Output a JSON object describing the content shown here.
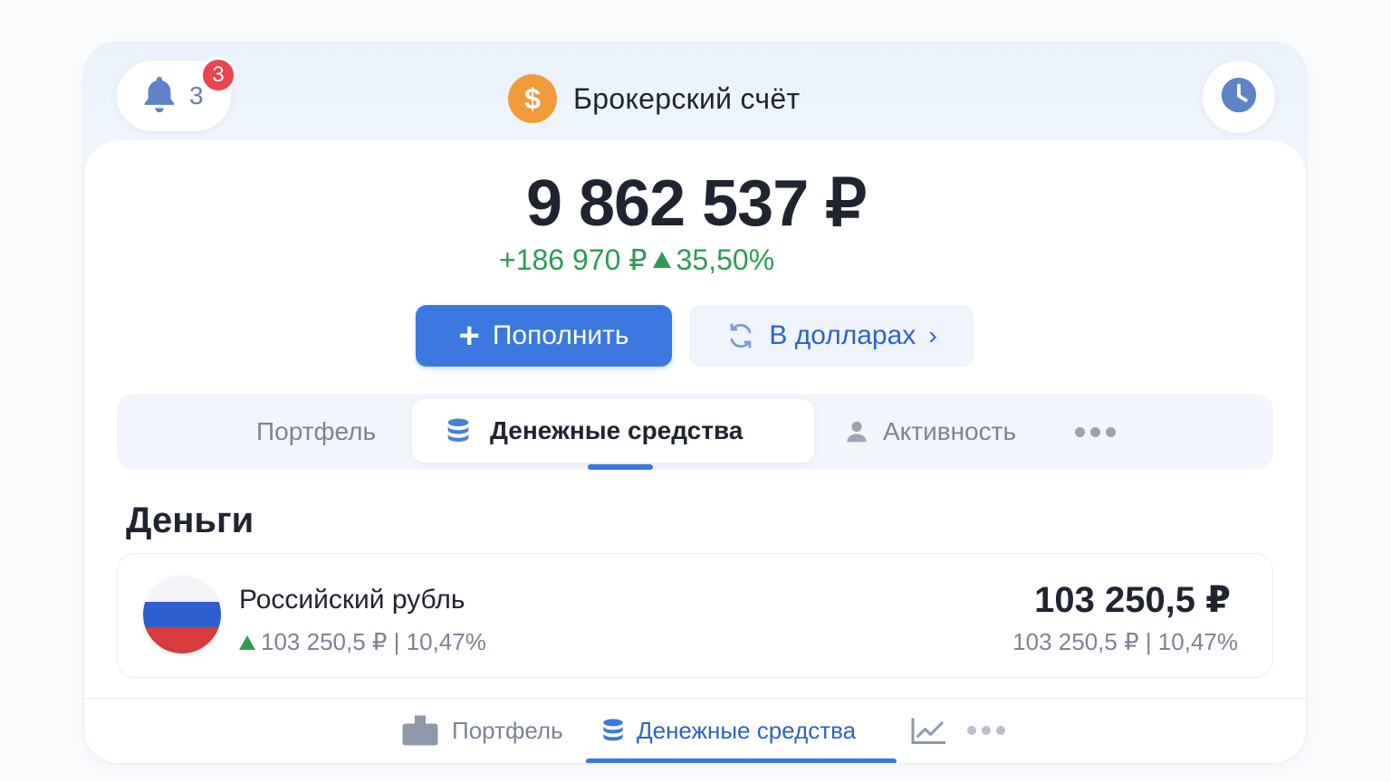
{
  "header": {
    "notifications_count": "3",
    "badge_count": "3",
    "title": "Брокерский счёт",
    "coin_symbol": "$"
  },
  "summary": {
    "balance": "9 862 537 ₽",
    "change_amount": "+186 970 ₽",
    "change_percent": "35,50%"
  },
  "actions": {
    "deposit_label": "Пополнить",
    "currency_label": "В долларах"
  },
  "tabs": {
    "portfolio": "Портфель",
    "cash": "Денежные средства",
    "activity": "Активность"
  },
  "money": {
    "section_title": "Деньги",
    "items": [
      {
        "name": "Российский рубль",
        "sub": "103 250,5 ₽ | 10,47%",
        "amount": "103 250,5 ₽",
        "amount_sub": "103 250,5 ₽ | 10,47%"
      }
    ]
  },
  "bottom_nav": {
    "portfolio": "Портфель",
    "cash": "Денежные средства"
  },
  "colors": {
    "accent": "#3a78e0",
    "positive": "#2f9a55",
    "badge": "#e9454a",
    "coin": "#f39a3b"
  }
}
